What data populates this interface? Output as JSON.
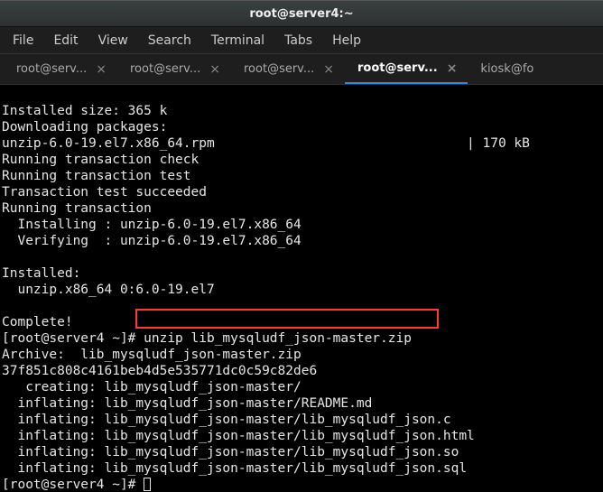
{
  "titlebar": {
    "title": "root@server4:~"
  },
  "menubar": {
    "items": [
      "File",
      "Edit",
      "View",
      "Search",
      "Terminal",
      "Tabs",
      "Help"
    ]
  },
  "tabs": [
    {
      "label": "root@serv...",
      "active": false,
      "closable": true
    },
    {
      "label": "root@serv...",
      "active": false,
      "closable": true
    },
    {
      "label": "root@serv...",
      "active": false,
      "closable": true
    },
    {
      "label": "root@serv...",
      "active": true,
      "closable": true
    },
    {
      "label": "kiosk@fo",
      "active": false,
      "closable": false
    }
  ],
  "terminal": {
    "lines": [
      "Installed size: 365 k",
      "Downloading packages:",
      "unzip-6.0-19.el7.x86_64.rpm                                | 170 kB",
      "Running transaction check",
      "Running transaction test",
      "Transaction test succeeded",
      "Running transaction",
      "  Installing : unzip-6.0-19.el7.x86_64",
      "  Verifying  : unzip-6.0-19.el7.x86_64",
      "",
      "Installed:",
      "  unzip.x86_64 0:6.0-19.el7",
      "",
      "Complete!",
      "[root@server4 ~]# unzip lib_mysqludf_json-master.zip",
      "Archive:  lib_mysqludf_json-master.zip",
      "37f851c808c4161beb4d5e535771dc0c59c82de6",
      "   creating: lib_mysqludf_json-master/",
      "  inflating: lib_mysqludf_json-master/README.md",
      "  inflating: lib_mysqludf_json-master/lib_mysqludf_json.c",
      "  inflating: lib_mysqludf_json-master/lib_mysqludf_json.html",
      "  inflating: lib_mysqludf_json-master/lib_mysqludf_json.so",
      "  inflating: lib_mysqludf_json-master/lib_mysqludf_json.sql"
    ],
    "prompt": "[root@server4 ~]# ",
    "highlight_command": "# unzip lib_mysqludf_json-master.zip"
  }
}
